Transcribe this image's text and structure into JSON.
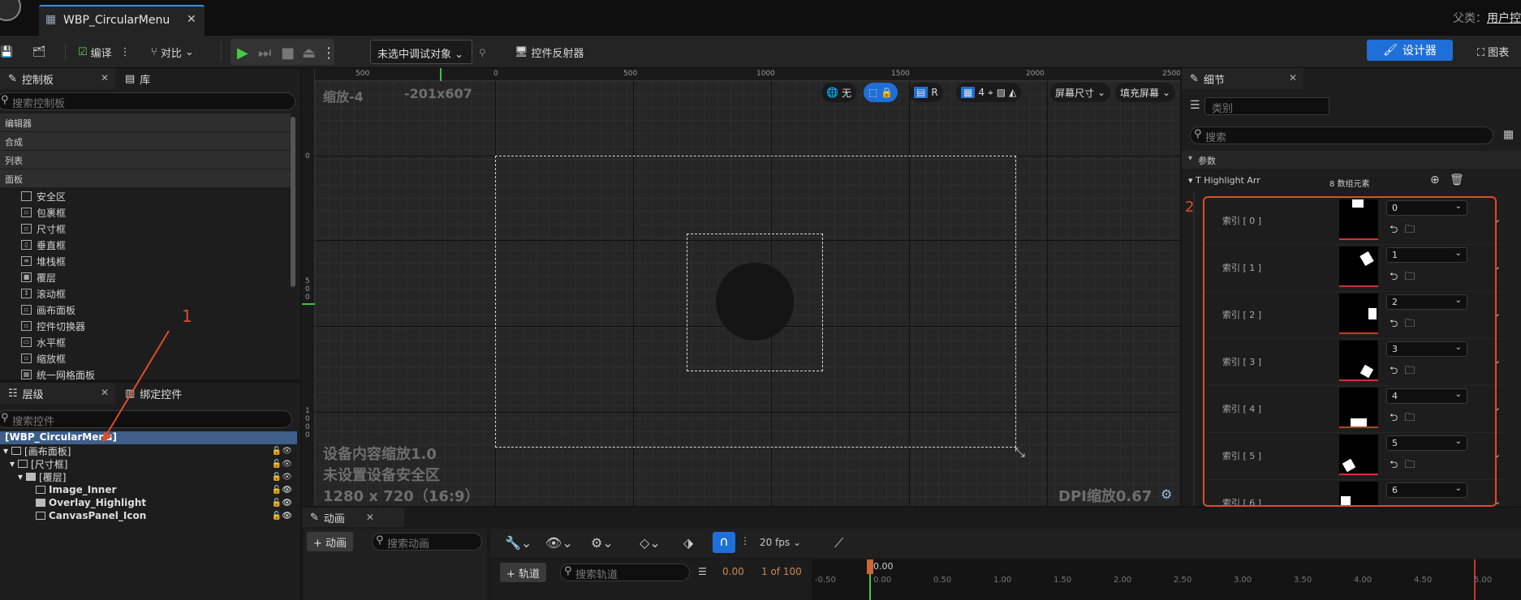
{
  "titlebar": {
    "tab_title": "WBP_CircularMenu",
    "close": "✕",
    "parent_label": "父类：",
    "parent_value": "用户控"
  },
  "toolbar": {
    "compile": "编译",
    "diff": "对比",
    "debug_object": "未选中调试对象",
    "widget_reflector": "控件反射器",
    "designer": "设计器",
    "graph": "图表"
  },
  "palette": {
    "tab": "控制板",
    "tab2": "库",
    "search_placeholder": "搜索控制板",
    "categories": [
      "编辑器",
      "合成",
      "列表",
      "面板"
    ],
    "widgets": [
      "安全区",
      "包裹框",
      "尺寸框",
      "垂直框",
      "堆栈框",
      "覆层",
      "滚动框",
      "画布面板",
      "控件切换器",
      "水平框",
      "缩放框",
      "统一网格面板"
    ]
  },
  "hierarchy": {
    "tab": "层级",
    "tab2": "绑定控件",
    "search_placeholder": "搜索控件",
    "root": "[WBP_CircularMenu]",
    "items": [
      {
        "label": "[画布面板]",
        "indent": 0
      },
      {
        "label": "[尺寸框]",
        "indent": 1
      },
      {
        "label": "[覆层]",
        "indent": 2
      },
      {
        "label": "Image_Inner",
        "indent": 3
      },
      {
        "label": "Overlay_Highlight",
        "indent": 3
      },
      {
        "label": "CanvasPanel_Icon",
        "indent": 3
      }
    ]
  },
  "viewport": {
    "zoom": "缩放-4",
    "size": "-201x607",
    "ruler_top": [
      "500",
      "0",
      "500",
      "1000",
      "1500",
      "2000",
      "2500"
    ],
    "ruler_left": [
      "0",
      "5",
      "0",
      "0",
      "1",
      "0",
      "0",
      "0"
    ],
    "device_text": [
      "设备内容缩放1.0",
      "未设置设备安全区",
      "1280 x 720（16:9）"
    ],
    "dpi": "DPI缩放0.67",
    "btn_none": "无",
    "btn_r": "R",
    "btn_grid": "4",
    "screen_size": "屏幕尺寸",
    "fill_screen": "填充屏幕"
  },
  "annotations": {
    "label1": "1",
    "label2": "2"
  },
  "details": {
    "tab": "细节",
    "class_placeholder": "类别",
    "search_placeholder": "搜索",
    "section": "参数",
    "array_label": "T Highlight Arr",
    "array_count": "8 数组元素",
    "rows": [
      {
        "label": "索引 [ 0 ]",
        "value": "0"
      },
      {
        "label": "索引 [ 1 ]",
        "value": "1"
      },
      {
        "label": "索引 [ 2 ]",
        "value": "2"
      },
      {
        "label": "索引 [ 3 ]",
        "value": "3"
      },
      {
        "label": "索引 [ 4 ]",
        "value": "4"
      },
      {
        "label": "索引 [ 5 ]",
        "value": "5"
      },
      {
        "label": "索引 [ 6 ]",
        "value": "6"
      }
    ]
  },
  "animation": {
    "tab": "动画",
    "add_button": "+ 动画",
    "search_placeholder": "搜索动画",
    "track_button": "+ 轨道",
    "track_search_placeholder": "搜索轨道",
    "fps": "20 fps",
    "time": "0.00",
    "frame": "1 of 100",
    "cursor": "0.00",
    "ticks": [
      "-0.50",
      "0.00",
      "0.50",
      "1.00",
      "1.50",
      "2.00",
      "2.50",
      "3.00",
      "3.50",
      "4.00",
      "4.50",
      "5.00"
    ]
  }
}
